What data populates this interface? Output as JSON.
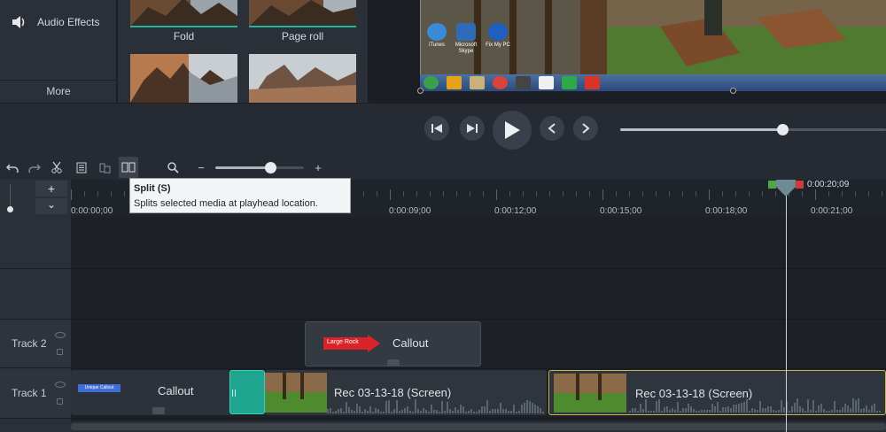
{
  "tool_panel": {
    "items": [
      {
        "label": "Audio Effects",
        "icon": "speaker-icon"
      }
    ],
    "more_label": "More"
  },
  "transitions": [
    {
      "label": "Fold"
    },
    {
      "label": "Page roll"
    },
    {
      "label": ""
    },
    {
      "label": ""
    }
  ],
  "preview": {
    "desktop_icons": [
      {
        "label": "iTunes"
      },
      {
        "label": "Microsoft Skype"
      },
      {
        "label": "Fix My PC"
      }
    ]
  },
  "playback": {
    "buttons": [
      "step-back",
      "step-forward",
      "play",
      "previous",
      "next"
    ],
    "progress": 0.61
  },
  "timeline_toolbar": {
    "tools": [
      "undo",
      "redo",
      "cut",
      "copy",
      "paste",
      "split"
    ],
    "zoom_minus": "−",
    "zoom_plus": "+",
    "zoom_level": 0.62
  },
  "track_controls": {
    "add": "+",
    "collapse": "⌄"
  },
  "ruler": {
    "labels": [
      "0:00:00;00",
      "0:00:09;00",
      "0:00:12;00",
      "0:00:15;00",
      "0:00:18;00",
      "0:00:21;00"
    ]
  },
  "playhead": {
    "time": "0:00:20;09"
  },
  "tooltip": {
    "title": "Split (S)",
    "body": "Splits selected media at playhead location."
  },
  "tracks": [
    {
      "name": "Track 2",
      "clips": [
        {
          "type": "callout",
          "title": "Callout",
          "arrow_text": "Large Rock"
        }
      ]
    },
    {
      "name": "Track 1",
      "clips": [
        {
          "type": "callout",
          "title": "Callout",
          "badge": "Unique Callout"
        },
        {
          "type": "screen",
          "title": "Rec 03-13-18 (Screen)"
        },
        {
          "type": "screen",
          "title": "Rec 03-13-18 (Screen)",
          "selected": true
        }
      ]
    }
  ],
  "colors": {
    "accent": "#1fb7a2",
    "selection": "#c7b44a",
    "callout_arrow": "#d8232a",
    "badge": "#3f6fd6"
  }
}
